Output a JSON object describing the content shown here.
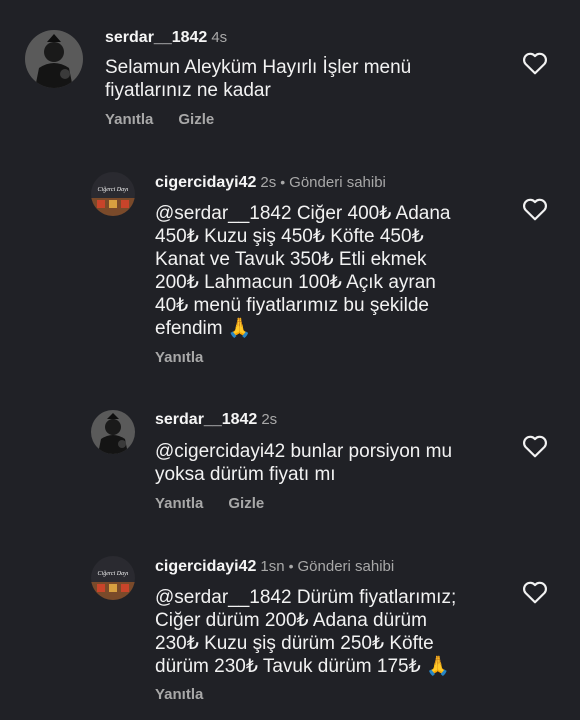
{
  "comments": [
    {
      "username": "serdar__1842",
      "time": "4s",
      "author_tag": "",
      "mention": "",
      "text": "Selamun Aleyküm Hayırlı İşler menü\nfiyatlarınız ne kadar",
      "reply_label": "Yanıtla",
      "hide_label": "Gizle"
    },
    {
      "username": "cigercidayi42",
      "time": "2s",
      "author_tag": "Gönderi sahibi",
      "mention": "@serdar__1842",
      "text": " Ciğer 400₺  Adana\n450₺  Kuzu şiş 450₺  Köfte 450₺\nKanat ve Tavuk 350₺  Etli ekmek\n200₺ Lahmacun 100₺  Açık ayran\n40₺  menü fiyatlarımız bu şekilde\nefendim 🙏",
      "reply_label": "Yanıtla",
      "hide_label": ""
    },
    {
      "username": "serdar__1842",
      "time": "2s",
      "author_tag": "",
      "mention": "@cigercidayi42",
      "text": " bunlar porsiyon mu\nyoksa dürüm fiyatı mı",
      "reply_label": "Yanıtla",
      "hide_label": "Gizle"
    },
    {
      "username": "cigercidayi42",
      "time": "1sn",
      "author_tag": "Gönderi sahibi",
      "mention": "@serdar__1842",
      "text": " Dürüm fiyatlarımız;\nCiğer dürüm 200₺  Adana dürüm\n230₺  Kuzu şiş dürüm 250₺  Köfte\ndürüm 230₺  Tavuk dürüm 175₺ 🙏",
      "reply_label": "Yanıtla",
      "hide_label": ""
    }
  ],
  "logo_text": "Ciğerci Dayı",
  "colors": {
    "background": "#202126",
    "text": "#f2f2f2",
    "muted": "#a8a8a8"
  },
  "icons": {
    "like": "heart-outline-icon"
  }
}
